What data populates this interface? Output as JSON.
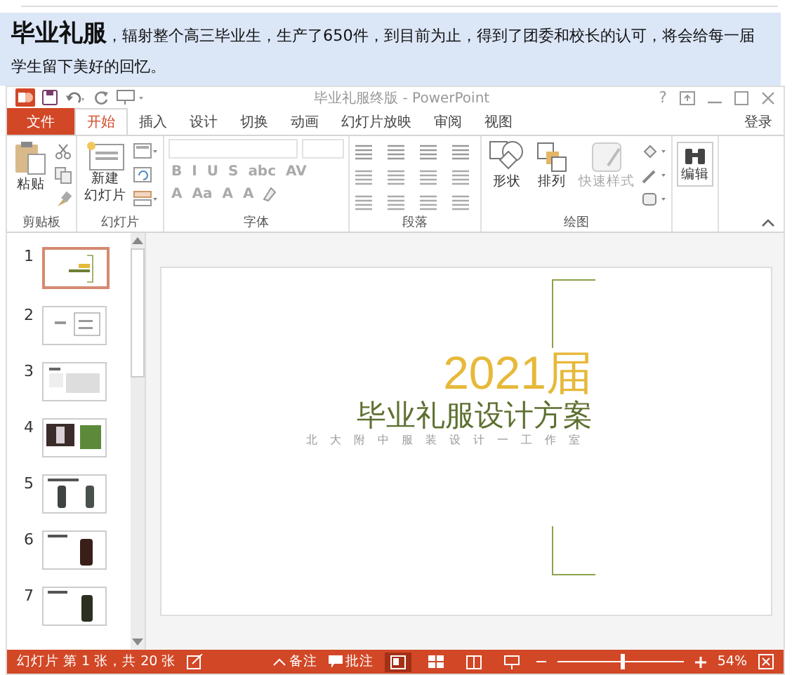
{
  "article": {
    "heading": "毕业礼服",
    "text": "，辐射整个高三毕业生，生产了650件，到目前为止，得到了团委和校长的认可，将会给每一届学生留下美好的回忆。"
  },
  "window": {
    "title": "毕业礼服终版 - PowerPoint",
    "help": "?"
  },
  "tabs": [
    {
      "label": "文件",
      "kind": "file",
      "selected": false
    },
    {
      "label": "开始",
      "kind": "tab",
      "selected": true
    },
    {
      "label": "插入",
      "kind": "tab",
      "selected": false
    },
    {
      "label": "设计",
      "kind": "tab",
      "selected": false
    },
    {
      "label": "切换",
      "kind": "tab",
      "selected": false
    },
    {
      "label": "动画",
      "kind": "tab",
      "selected": false
    },
    {
      "label": "幻灯片放映",
      "kind": "tab",
      "selected": false
    },
    {
      "label": "审阅",
      "kind": "tab",
      "selected": false
    },
    {
      "label": "视图",
      "kind": "tab",
      "selected": false
    }
  ],
  "sign_in": "登录",
  "ribbon": [
    {
      "kind": "clipboard",
      "label": "剪贴板",
      "buttons": [
        {
          "label": "粘贴",
          "disabled": false
        }
      ]
    },
    {
      "kind": "slides",
      "label": "幻灯片",
      "buttons": [
        {
          "label": "新建",
          "disabled": false
        },
        {
          "label": "幻灯片",
          "disabled": false
        }
      ]
    },
    {
      "kind": "font",
      "label": "字体",
      "glyphs": [
        "B",
        "I",
        "U",
        "S",
        "abc",
        "AV",
        "A",
        "Aa",
        "A",
        "A"
      ]
    },
    {
      "kind": "paragraph",
      "label": "段落"
    },
    {
      "kind": "drawing",
      "label": "绘图",
      "buttons": [
        {
          "label": "形状",
          "disabled": false
        },
        {
          "label": "排列",
          "disabled": false
        },
        {
          "label": "快速样式",
          "disabled": true
        }
      ]
    },
    {
      "kind": "editing",
      "buttons": [
        {
          "label": "编辑",
          "disabled": false
        }
      ]
    }
  ],
  "slides": [
    {
      "number": "1",
      "kind": "title",
      "selected": true
    },
    {
      "number": "2",
      "kind": "diagram",
      "selected": false
    },
    {
      "number": "3",
      "kind": "text",
      "selected": false
    },
    {
      "number": "4",
      "kind": "photos",
      "selected": false
    },
    {
      "number": "5",
      "kind": "two-figures",
      "selected": false
    },
    {
      "number": "6",
      "kind": "figure",
      "selected": false
    },
    {
      "number": "7",
      "kind": "figure-dark",
      "selected": false
    }
  ],
  "slide": {
    "year": "2021届",
    "title": "毕业礼服设计方案",
    "subtitle": "北大附中服装设计一工作室"
  },
  "status_bar": {
    "slide_info": "幻灯片 第 1 张，共 20 张",
    "notes": "备注",
    "comments": "批注",
    "views": [
      {
        "kind": "normal",
        "selected": true
      },
      {
        "kind": "sorter",
        "selected": false
      },
      {
        "kind": "reading",
        "selected": false
      },
      {
        "kind": "show",
        "selected": false
      }
    ],
    "zoom_slider": {
      "level": 0.52
    },
    "zoom": "54%"
  }
}
